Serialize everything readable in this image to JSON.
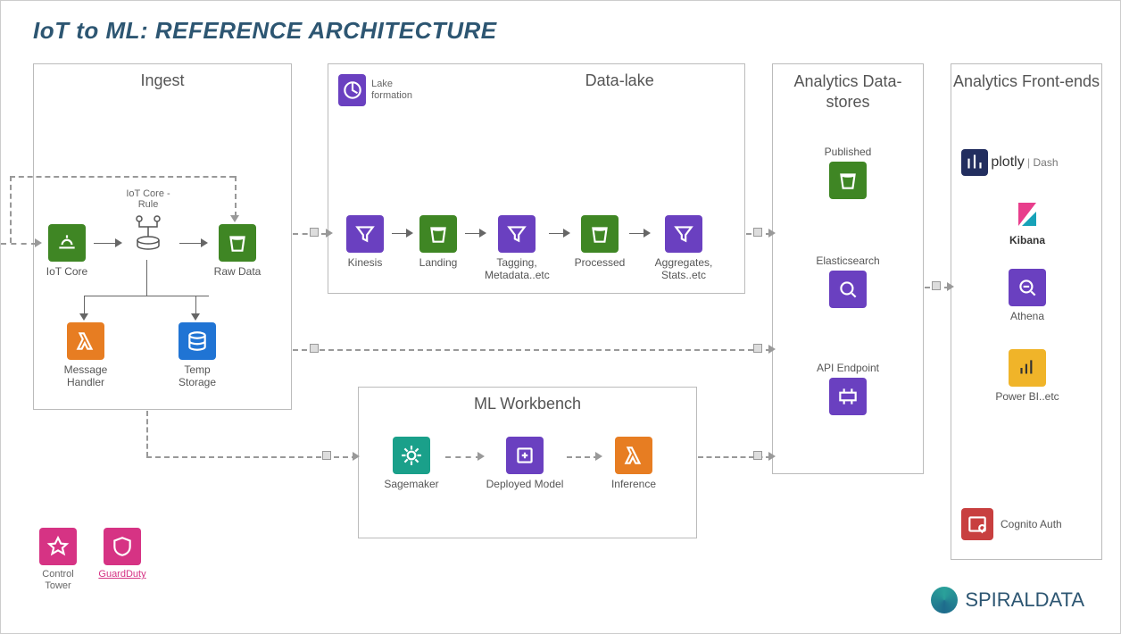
{
  "title": "IoT to ML: REFERENCE ARCHITECTURE",
  "boxes": {
    "ingest": "Ingest",
    "datalake": "Data-lake",
    "ml": "ML Workbench",
    "datastores": "Analytics Data-stores",
    "frontends": "Analytics Front-ends"
  },
  "ingest": {
    "iotcore": "IoT Core",
    "rule": "IoT Core - Rule",
    "raw": "Raw Data",
    "handler": "Message Handler",
    "temp": "Temp Storage"
  },
  "datalake": {
    "lake": "Lake formation",
    "kinesis": "Kinesis",
    "landing": "Landing",
    "tagging": "Tagging, Metadata..etc",
    "processed": "Processed",
    "aggregates": "Aggregates, Stats..etc"
  },
  "ml": {
    "sagemaker": "Sagemaker",
    "deployed": "Deployed Model",
    "inference": "Inference"
  },
  "stores": {
    "published": "Published",
    "elastic": "Elasticsearch",
    "api": "API Endpoint"
  },
  "frontends": {
    "plotly": "plotly",
    "dash": "Dash",
    "kibana": "Kibana",
    "athena": "Athena",
    "powerbi": "Power BI..etc",
    "cognito": "Cognito Auth"
  },
  "security": {
    "tower": "Control Tower",
    "guard": "GuardDuty"
  },
  "brand": "SPIRALDATA"
}
